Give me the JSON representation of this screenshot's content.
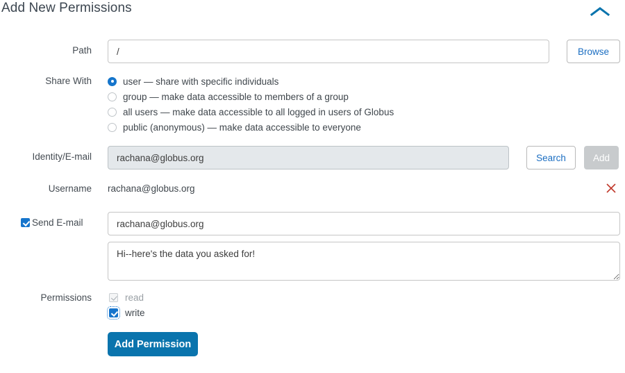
{
  "header": {
    "title": "Add New Permissions",
    "collapse_icon": "chevron-up-icon",
    "accent_color": "#0a74ad"
  },
  "form": {
    "path": {
      "label": "Path",
      "value": "/",
      "placeholder": "",
      "browse_label": "Browse"
    },
    "share_with": {
      "label": "Share With",
      "selected": "user",
      "options": [
        {
          "id": "user",
          "text": "user — share with specific individuals",
          "selected": true
        },
        {
          "id": "group",
          "text": "group — make data accessible to members of a group",
          "selected": false
        },
        {
          "id": "all-users",
          "text": "all users — make data accessible to all logged in users of Globus",
          "selected": false
        },
        {
          "id": "public",
          "text": "public (anonymous) — make data accessible to everyone",
          "selected": false
        }
      ]
    },
    "identity": {
      "label": "Identity/E-mail",
      "value": "rachana@globus.org",
      "placeholder": "",
      "disabled": true,
      "search_label": "Search",
      "add_label": "Add",
      "add_disabled": true
    },
    "username": {
      "label": "Username",
      "value": "rachana@globus.org",
      "remove_icon": "close-icon",
      "remove_color": "#c0392b"
    },
    "send_email": {
      "label": "Send E-mail",
      "checked": true,
      "email_value": "rachana@globus.org",
      "email_placeholder": "",
      "message_value": "Hi--here's the data you asked for!",
      "message_placeholder": ""
    },
    "permissions": {
      "label": "Permissions",
      "items": [
        {
          "id": "read",
          "label": "read",
          "checked": true,
          "disabled": true,
          "focused": false
        },
        {
          "id": "write",
          "label": "write",
          "checked": true,
          "disabled": false,
          "focused": true
        }
      ]
    },
    "submit": {
      "label": "Add Permission"
    }
  }
}
